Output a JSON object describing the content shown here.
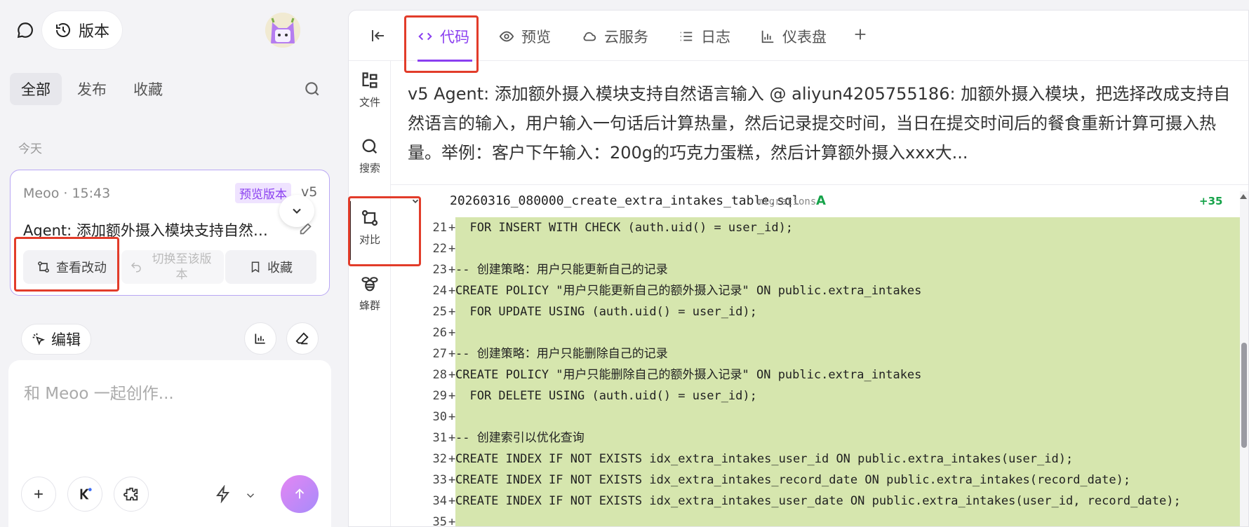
{
  "left_panel": {
    "version_label": "版本",
    "filters": [
      "全部",
      "发布",
      "收藏"
    ],
    "section_label": "今天",
    "card": {
      "meta": "Meoo · 15:43",
      "badge": "预览版本",
      "version": "v5",
      "title": "Agent: 添加额外摄入模块支持自然语...",
      "view_changes": "查看改动",
      "switch_version": "切换至该版本",
      "favorite": "收藏"
    },
    "edit_label": "编辑",
    "input_placeholder": "和 Meoo 一起创作..."
  },
  "right_panel": {
    "tabs": [
      {
        "label": "代码",
        "icon": "code-icon"
      },
      {
        "label": "预览",
        "icon": "eye-icon"
      },
      {
        "label": "云服务",
        "icon": "cloud-icon"
      },
      {
        "label": "日志",
        "icon": "list-icon"
      },
      {
        "label": "仪表盘",
        "icon": "chart-icon"
      }
    ],
    "side_nav": [
      {
        "label": "文件",
        "icon": "files-icon"
      },
      {
        "label": "搜索",
        "icon": "search-icon"
      },
      {
        "label": "对比",
        "icon": "diff-icon"
      },
      {
        "label": "蜂群",
        "icon": "bee-icon"
      }
    ],
    "commit_message": "v5 Agent: 添加额外摄入模块支持自然语言输入 @ aliyun4205755186: 加额外摄入模块，把选择改成支持自然语言的输入，用户输入一句话后计算热量，然后记录提交时间，当日在提交时间后的餐食重新计算可摄入热量。举例：客户下午输入：200g的巧克力蛋糕，然后计算额外摄入xxx大...",
    "diff": {
      "filename": "20260316_080000_create_extra_intakes_table.sql",
      "directory": "migrations",
      "status": "A",
      "additions": "+35",
      "lines": [
        {
          "n": "21",
          "text": "  FOR INSERT WITH CHECK (auth.uid() = user_id);"
        },
        {
          "n": "22",
          "text": ""
        },
        {
          "n": "23",
          "text": "-- 创建策略：用户只能更新自己的记录"
        },
        {
          "n": "24",
          "text": "CREATE POLICY \"用户只能更新自己的额外摄入记录\" ON public.extra_intakes"
        },
        {
          "n": "25",
          "text": "  FOR UPDATE USING (auth.uid() = user_id);"
        },
        {
          "n": "26",
          "text": ""
        },
        {
          "n": "27",
          "text": "-- 创建策略：用户只能删除自己的记录"
        },
        {
          "n": "28",
          "text": "CREATE POLICY \"用户只能删除自己的额外摄入记录\" ON public.extra_intakes"
        },
        {
          "n": "29",
          "text": "  FOR DELETE USING (auth.uid() = user_id);"
        },
        {
          "n": "30",
          "text": ""
        },
        {
          "n": "31",
          "text": "-- 创建索引以优化查询"
        },
        {
          "n": "32",
          "text": "CREATE INDEX IF NOT EXISTS idx_extra_intakes_user_id ON public.extra_intakes(user_id);"
        },
        {
          "n": "33",
          "text": "CREATE INDEX IF NOT EXISTS idx_extra_intakes_record_date ON public.extra_intakes(record_date);"
        },
        {
          "n": "34",
          "text": "CREATE INDEX IF NOT EXISTS idx_extra_intakes_user_date ON public.extra_intakes(user_id, record_date);"
        },
        {
          "n": "35",
          "text": ""
        }
      ]
    }
  },
  "colors": {
    "accent": "#8a3ff0",
    "added_line_bg": "#d6e6ae",
    "highlight_box": "#e23c2a",
    "added_status": "#16a34a"
  }
}
